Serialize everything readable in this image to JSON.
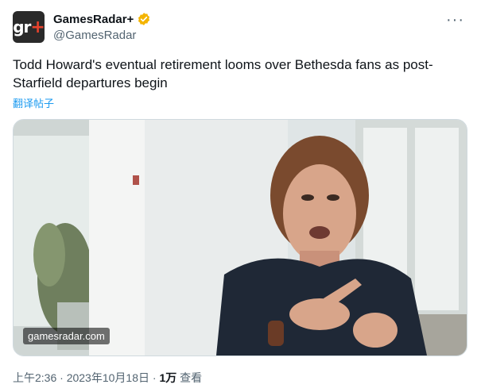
{
  "author": {
    "display_name": "GamesRadar+",
    "handle": "@GamesRadar",
    "avatar_text": "gr",
    "avatar_plus": "+",
    "verified_color": "#f4b400"
  },
  "more_label": "···",
  "tweet": {
    "text": "Todd Howard's eventual retirement looms over Bethesda fans as post-Starfield departures begin",
    "translate_label": "翻译帖子"
  },
  "media": {
    "watermark": "gamesradar.com"
  },
  "meta": {
    "time": "上午2:36",
    "date": "2023年10月18日",
    "views_count": "1万",
    "views_label": "查看",
    "separator": "·"
  }
}
